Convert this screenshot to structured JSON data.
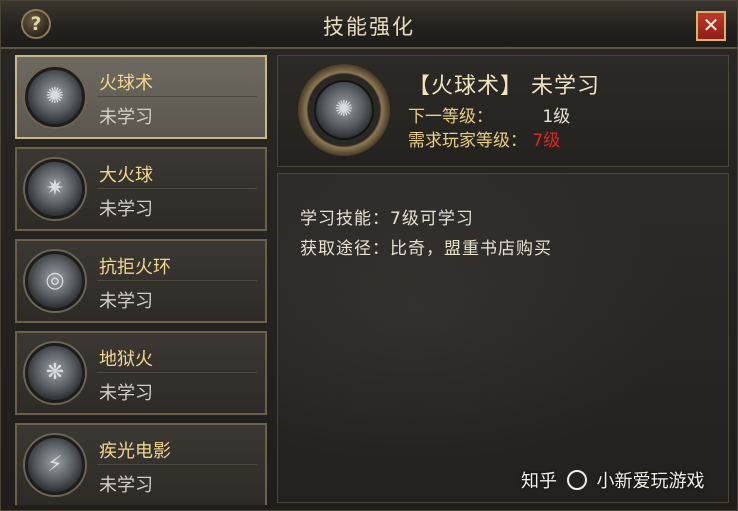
{
  "window": {
    "title": "技能强化",
    "help_label": "?",
    "close_label": "✕"
  },
  "skills": [
    {
      "name": "火球术",
      "status": "未学习",
      "icon": "fireball-icon",
      "selected": true
    },
    {
      "name": "大火球",
      "status": "未学习",
      "icon": "big-fireball-icon",
      "selected": false
    },
    {
      "name": "抗拒火环",
      "status": "未学习",
      "icon": "repel-fire-ring-icon",
      "selected": false
    },
    {
      "name": "地狱火",
      "status": "未学习",
      "icon": "hellfire-icon",
      "selected": false
    },
    {
      "name": "疾光电影",
      "status": "未学习",
      "icon": "lightning-icon",
      "selected": false
    }
  ],
  "detail": {
    "title": "【火球术】 未学习",
    "next_level_label": "下一等级：",
    "next_level_value": "1级",
    "required_level_label": "需求玩家等级：",
    "required_level_value": "7级",
    "learn_skill": "学习技能：7级可学习",
    "obtain_method": "获取途径：比奇，盟重书店购买",
    "icon": "fireball-icon"
  },
  "watermark": {
    "text_left": "知乎",
    "text_right": "小新爱玩游戏"
  },
  "colors": {
    "accent_gold": "#f0d68e",
    "warning_red": "#e0261f",
    "selected_border": "#c9b68b"
  }
}
